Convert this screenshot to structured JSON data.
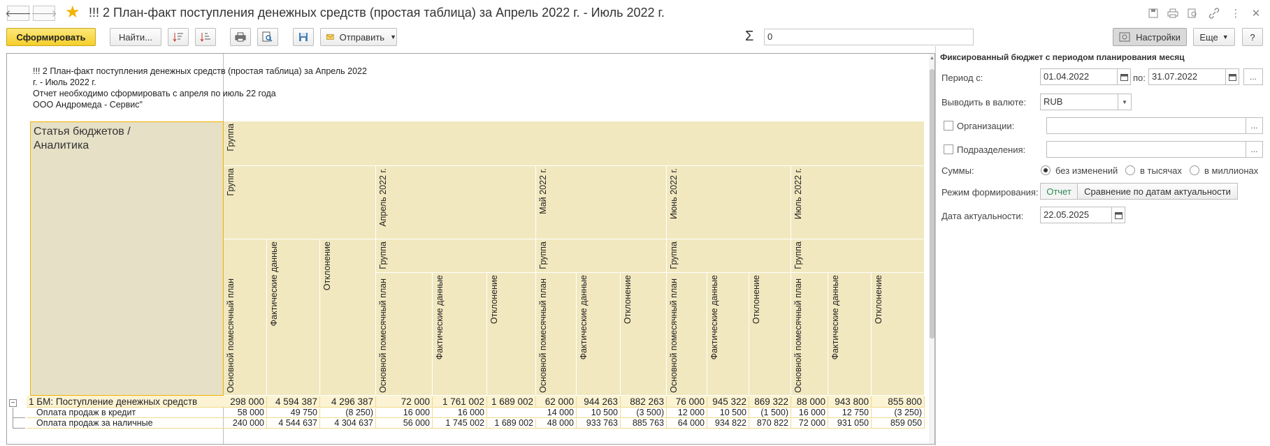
{
  "window": {
    "title": "!!! 2 План-факт поступления денежных средств (простая таблица)  за Апрель 2022 г. - Июль 2022 г.",
    "back_glyph": "🡐",
    "forward_glyph": "🡒"
  },
  "toolbar": {
    "generate_label": "Сформировать",
    "find_label": "Найти...",
    "send_label": "Отправить",
    "sum_symbol": "Σ",
    "sum_value": "0",
    "settings_label": "Настройки",
    "more_label": "Еще",
    "help_label": "?"
  },
  "report": {
    "header_lines": [
      "!!! 2 План-факт поступления денежных средств (простая таблица) за Апрель 2022",
      "г. - Июль 2022 г.",
      " Отчет необходимо сформировать с апреля по июль 22 года",
      "ООО Андромеда - Сервис\""
    ],
    "corner_label_1": "Статья бюджетов /",
    "corner_label_2": "Аналитика",
    "group_label": "Группа",
    "columns": {
      "plan": "Основной помесячный план",
      "fact": "Фактические данные",
      "dev": "Отклонение"
    },
    "periods": [
      "Апрель 2022 г.",
      "Май 2022 г.",
      "Июнь 2022 г.",
      "Июль 2022 г."
    ],
    "rows": [
      {
        "name": "1 БМ: Поступление денежных средств",
        "values": [
          "298 000",
          "4 594 387",
          "4 296 387",
          "72 000",
          "1 761 002",
          "1 689 002",
          "62 000",
          "944 263",
          "882 263",
          "76 000",
          "945 322",
          "869 322",
          "88 000",
          "943 800",
          "855 800"
        ]
      },
      {
        "name": "Оплата продаж в кредит",
        "values": [
          "58 000",
          "49 750",
          "(8 250)",
          "16 000",
          "16 000",
          "",
          "14 000",
          "10 500",
          "(3 500)",
          "12 000",
          "10 500",
          "(1 500)",
          "16 000",
          "12 750",
          "(3 250)"
        ]
      },
      {
        "name": "Оплата продаж за наличные",
        "values": [
          "240 000",
          "4 544 637",
          "4 304 637",
          "56 000",
          "1 745 002",
          "1 689 002",
          "48 000",
          "933 763",
          "885 763",
          "64 000",
          "934 822",
          "870 822",
          "72 000",
          "931 050",
          "859 050"
        ]
      }
    ],
    "collapse_glyph": "−"
  },
  "panel": {
    "title": "Фиксированный бюджет с периодом планирования месяц",
    "period_from_label": "Период с:",
    "period_from": "01.04.2022",
    "period_to_label": "по:",
    "period_to": "31.07.2022",
    "ellipsis": "...",
    "currency_label": "Выводить в валюте:",
    "currency": "RUB",
    "org_label": "Организации:",
    "dept_label": "Подразделения:",
    "sums_label": "Суммы:",
    "sums_options": [
      "без изменений",
      "в тысячах",
      "в миллионах"
    ],
    "mode_label": "Режим формирования:",
    "mode_report": "Отчет",
    "mode_compare": "Сравнение по датам актуальности",
    "date_label": "Дата актуальности:",
    "date_value": "22.05.2025"
  },
  "colors": {
    "header_bg": "#f2e8c0",
    "corner_bg": "#e6e0c6",
    "primary_button": "#f5cf2b",
    "active_mode_text": "#2e8b57"
  }
}
